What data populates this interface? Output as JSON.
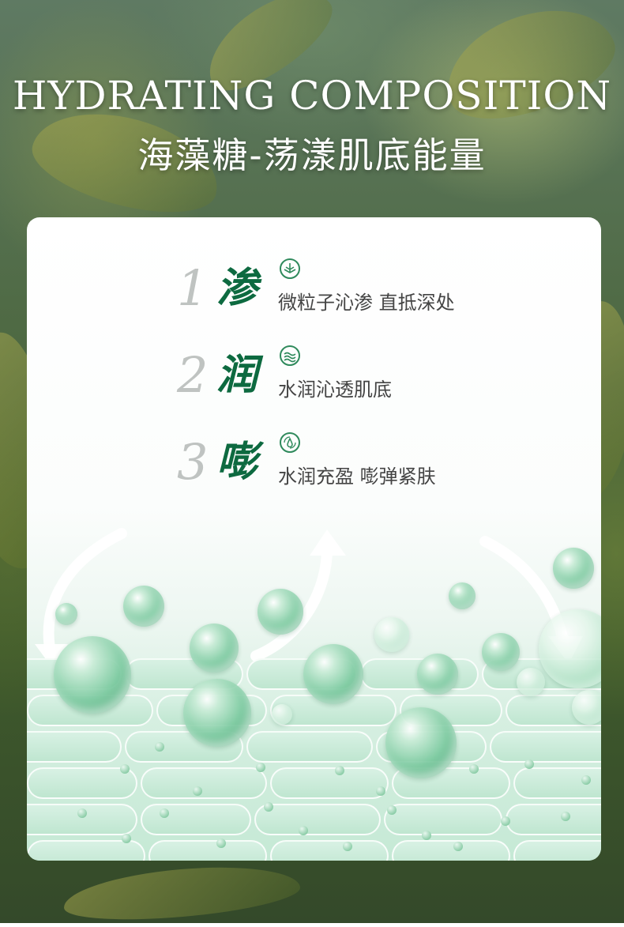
{
  "header": {
    "title_en": "HYDRATING COMPOSITION",
    "title_cn": "海藻糖-荡漾肌底能量"
  },
  "features": [
    {
      "num": "1",
      "char": "渗",
      "icon": "wave-filter-icon",
      "desc": "微粒子沁渗 直抵深处"
    },
    {
      "num": "2",
      "char": "润",
      "icon": "water-wave-icon",
      "desc": "水润沁透肌底"
    },
    {
      "num": "3",
      "char": "嘭",
      "icon": "water-drop-cycle-icon",
      "desc": "水润充盈 嘭弹紧肤"
    }
  ],
  "colors": {
    "accent": "#0d6a40",
    "number": "#bfc3c1",
    "text": "#444444"
  }
}
